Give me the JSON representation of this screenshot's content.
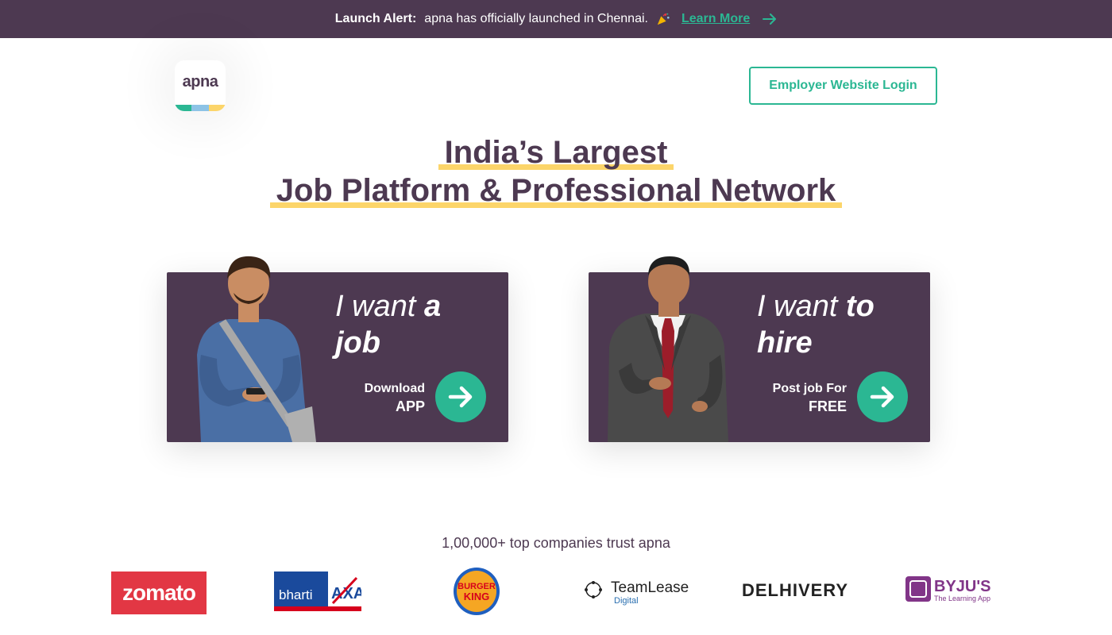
{
  "banner": {
    "alert_label": "Launch Alert:",
    "message": "apna has officially launched in Chennai.",
    "link_label": "Learn More"
  },
  "logo": {
    "text": "apna"
  },
  "header": {
    "employer_login_label": "Employer Website Login"
  },
  "hero": {
    "line1": "India’s Largest",
    "line2": "Job Platform & Professional Network"
  },
  "cards": {
    "job": {
      "title_light": "I want ",
      "title_bold": "a job",
      "cta_line1": "Download",
      "cta_line2": "APP"
    },
    "hire": {
      "title_light": "I want ",
      "title_bold": "to hire",
      "cta_line1": "Post job For",
      "cta_line2": "FREE"
    }
  },
  "trust": {
    "heading": "1,00,000+ top companies trust apna",
    "companies": [
      {
        "name": "zomato",
        "label": "zomato"
      },
      {
        "name": "bharti-axa",
        "label": "bharti AXA"
      },
      {
        "name": "burger-king",
        "label": "BURGER KING"
      },
      {
        "name": "teamlease",
        "label": "TeamLease",
        "sub": "Digital"
      },
      {
        "name": "delhivery",
        "label": "DELHIVERY"
      },
      {
        "name": "byjus",
        "label": "BYJU'S",
        "sub": "The Learning App"
      }
    ]
  },
  "colors": {
    "brand_purple": "#4d3951",
    "accent_green": "#2bb793",
    "highlight_yellow": "#fcd56a",
    "logo_blue": "#8dc3e6"
  },
  "icons": {
    "banner_emoji": "party-popper-icon",
    "banner_arrow": "arrow-right-icon",
    "cta_arrow": "arrow-right-icon"
  }
}
